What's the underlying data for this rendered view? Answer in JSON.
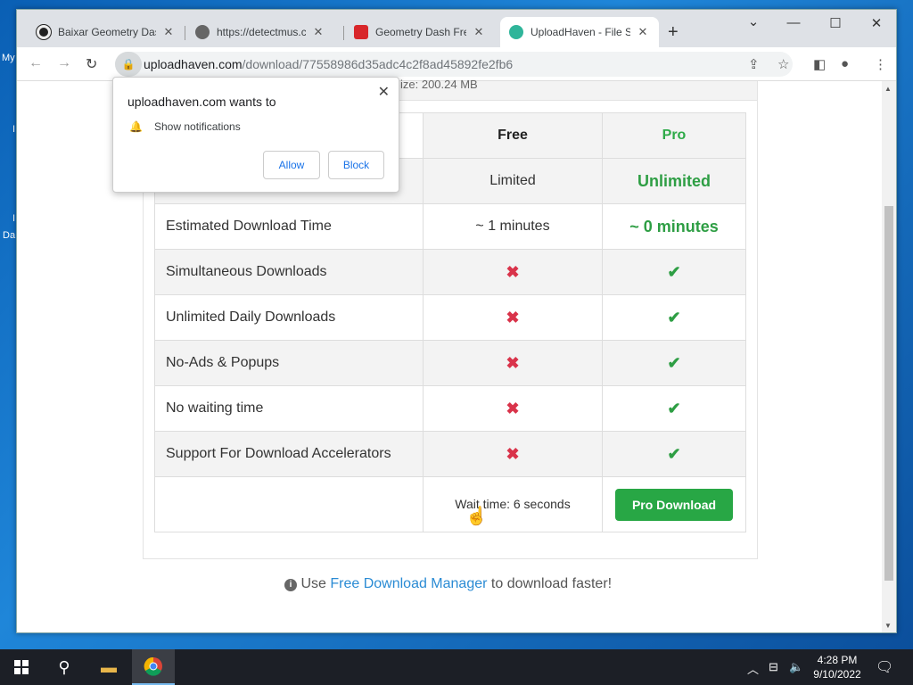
{
  "desktop": {
    "labels": [
      "My",
      "I",
      "I",
      "Da"
    ]
  },
  "browser": {
    "tabs": [
      {
        "title": "Baixar Geometry Dash",
        "icon": "app-icon"
      },
      {
        "title": "https://detectmus.co",
        "icon": "globe-icon"
      },
      {
        "title": "Geometry Dash Free",
        "icon": "app-icon"
      },
      {
        "title": "UploadHaven - File S",
        "icon": "uploadhaven-icon"
      }
    ],
    "url_host": "uploadhaven.com",
    "url_path": "/download/77558986d35adc4c2f8ad45892fe2fb6"
  },
  "page": {
    "top_fragment": "ize: 200.24 MB",
    "table": {
      "header": {
        "free": "Free",
        "pro": "Pro"
      },
      "rows": [
        {
          "feature": "",
          "free": "Limited",
          "pro": "Unlimited"
        },
        {
          "feature": "Estimated Download Time",
          "free": "~ 1 minutes",
          "pro": "~ 0 minutes"
        },
        {
          "feature": "Simultaneous Downloads",
          "free": "✖",
          "pro": "✔"
        },
        {
          "feature": "Unlimited Daily Downloads",
          "free": "✖",
          "pro": "✔"
        },
        {
          "feature": "No-Ads & Popups",
          "free": "✖",
          "pro": "✔"
        },
        {
          "feature": "No waiting time",
          "free": "✖",
          "pro": "✔"
        },
        {
          "feature": "Support For Download Accelerators",
          "free": "✖",
          "pro": "✔"
        }
      ],
      "wait_text": "Wait time: 6 seconds",
      "pro_button": "Pro Download"
    },
    "footer": {
      "prefix": "Use",
      "link": "Free Download Manager",
      "suffix": "to download faster!"
    }
  },
  "popup": {
    "title": "uploadhaven.com wants to",
    "permission": "Show notifications",
    "allow": "Allow",
    "block": "Block"
  },
  "taskbar": {
    "time": "4:28 PM",
    "date": "9/10/2022"
  },
  "colors": {
    "pro_green": "#2e9e44",
    "button_green": "#28a745",
    "x_red": "#d9334a",
    "link_blue": "#2a8bd4"
  }
}
